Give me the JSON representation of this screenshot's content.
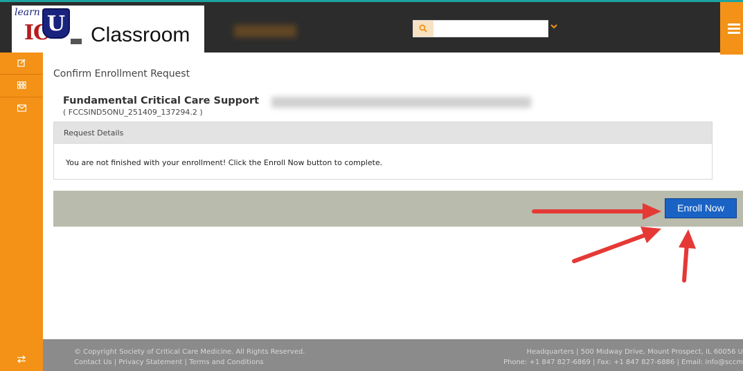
{
  "header": {
    "logo": {
      "learn": "learn",
      "ic": "IC",
      "shield_letter": "U",
      "classroom": "Classroom"
    },
    "search": {
      "placeholder": ""
    },
    "icons": {
      "search": "search-icon",
      "chevron": "chevron-down-icon",
      "menu": "menu-icon"
    }
  },
  "sidebar": {
    "items": [
      {
        "icon": "edit-icon"
      },
      {
        "icon": "grid-icon"
      },
      {
        "icon": "mail-icon"
      }
    ],
    "bottom_icon": "swap-icon"
  },
  "main": {
    "page_title": "Confirm Enrollment Request",
    "course_title": "Fundamental Critical Care Support",
    "course_code": "( FCCSIND5ONU_251409_137294.2 )",
    "details_header": "Request Details",
    "details_message": "You are not finished with your enrollment! Click the Enroll Now button to complete.",
    "enroll_button": "Enroll Now"
  },
  "footer": {
    "copyright": "© Copyright Society of Critical Care Medicine. All Rights Reserved.",
    "links": "Contact Us | Privacy Statement | Terms and Conditions",
    "address": "Headquarters | 500 Midway Drive, Mount Prospect, IL 60056 U",
    "contact": "Phone: +1 847 827-6869 | Fax: +1 847 827-6886 | Email: info@sccm"
  },
  "colors": {
    "accent": "#f39217",
    "topbar": "#2c2c2c",
    "button": "#1a63c4",
    "arrow": "#e53935"
  }
}
